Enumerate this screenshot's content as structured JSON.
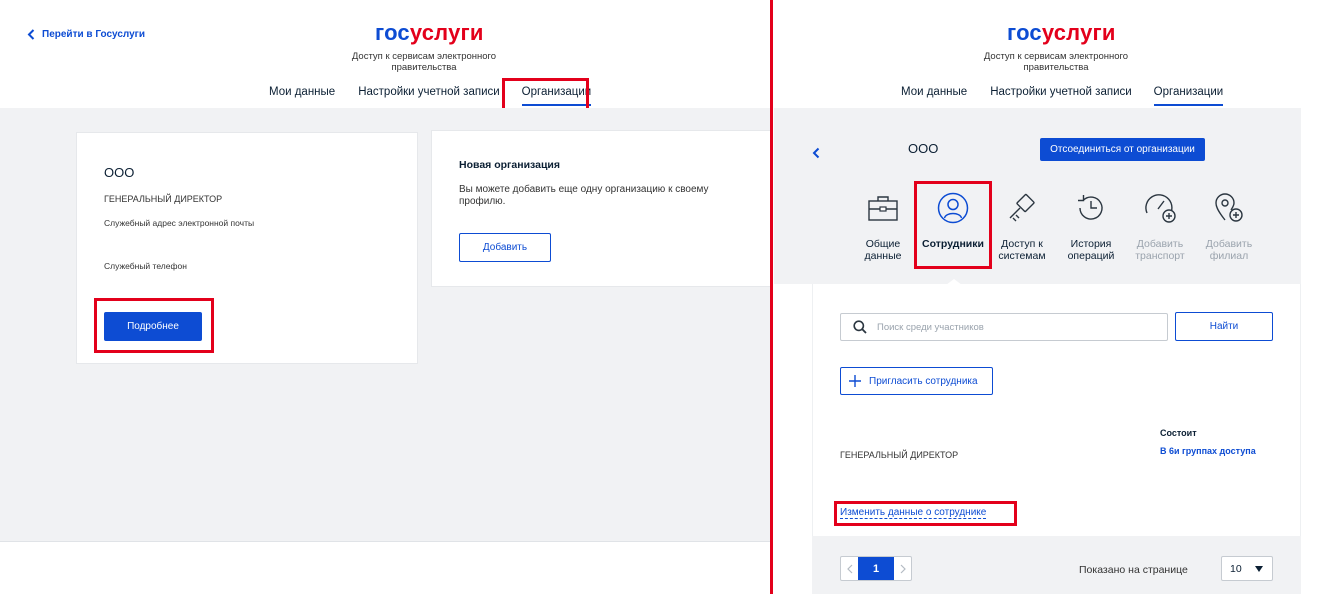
{
  "brand": {
    "gos": "гос",
    "uslugi": "услуги",
    "subtitle": "Доступ к сервисам электронного правительства"
  },
  "colors": {
    "primary": "#0d4cd3",
    "highlight": "#e3001b",
    "background": "#f1f2f4"
  },
  "nav": [
    {
      "label": "Мои данные"
    },
    {
      "label": "Настройки учетной записи"
    },
    {
      "label": "Организации"
    }
  ],
  "left": {
    "back_link": "Перейти в Госуслуги",
    "org_card": {
      "name": "ООО",
      "position": "ГЕНЕРАЛЬНЫЙ ДИРЕКТОР",
      "email_label": "Служебный адрес электронной почты",
      "phone_label": "Служебный телефон",
      "details_button": "Подробнее"
    },
    "new_org_card": {
      "title": "Новая организация",
      "description": "Вы можете добавить еще одну организацию к своему профилю.",
      "add_button": "Добавить"
    }
  },
  "right": {
    "org_name": "ООО",
    "disconnect_button": "Отсоединиться от организации",
    "tabs": [
      {
        "line1": "Общие",
        "line2": "данные",
        "icon": "briefcase-icon"
      },
      {
        "line1": "Сотрудники",
        "line2": "",
        "icon": "user-circle-icon"
      },
      {
        "line1": "Доступ к",
        "line2": "системам",
        "icon": "key-icon"
      },
      {
        "line1": "История",
        "line2": "операций",
        "icon": "history-icon"
      },
      {
        "line1": "Добавить",
        "line2": "транспорт",
        "icon": "speedometer-add-icon"
      },
      {
        "line1": "Добавить",
        "line2": "филиал",
        "icon": "location-add-icon"
      }
    ],
    "search_placeholder": "Поиск среди участников",
    "find_button": "Найти",
    "invite_button": "Пригласить сотрудника",
    "employee": {
      "position": "ГЕНЕРАЛЬНЫЙ ДИРЕКТОР",
      "status_header": "Состоит",
      "status_value": "В 6и группах доступа",
      "edit_link": "Изменить данные о сотруднике"
    },
    "pagination": {
      "current_page": "1",
      "shown_label": "Показано на странице",
      "per_page": "10"
    }
  }
}
